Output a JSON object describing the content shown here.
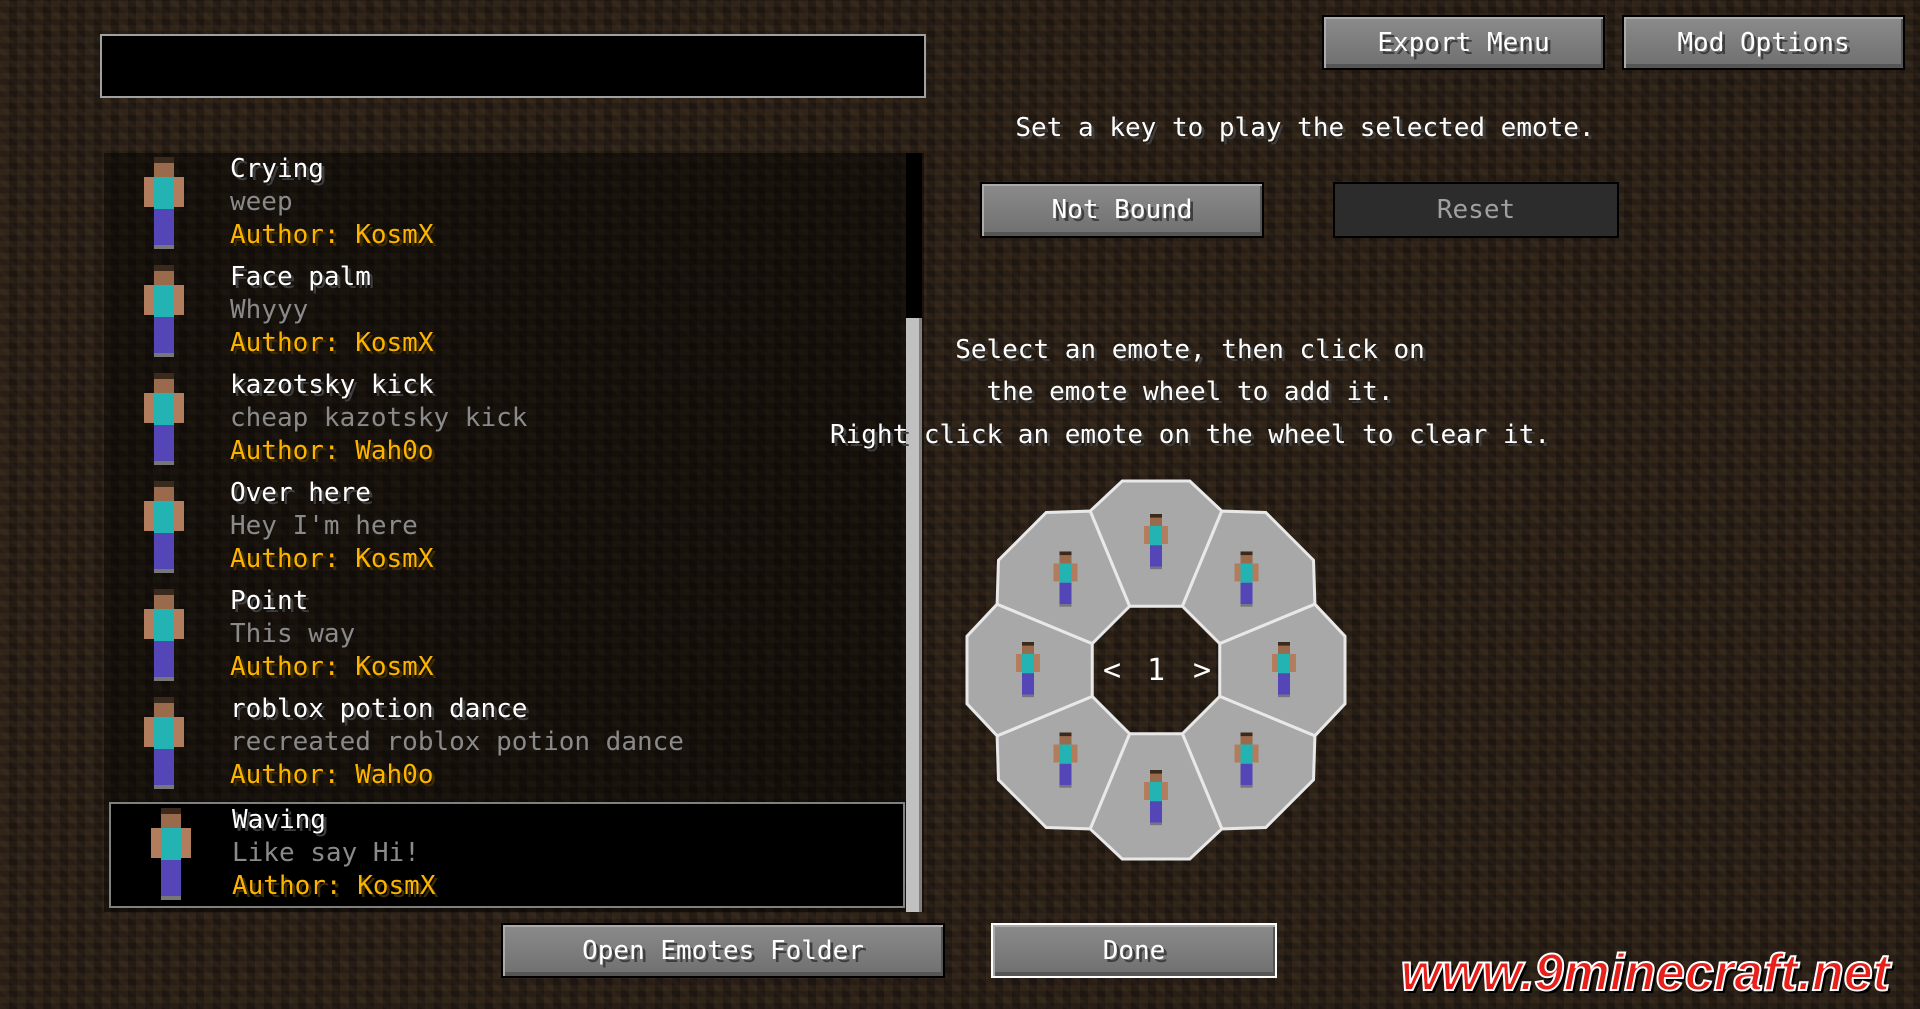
{
  "search": {
    "value": "",
    "placeholder": ""
  },
  "header": {
    "export_label": "Export Menu",
    "mod_options_label": "Mod Options"
  },
  "keybind": {
    "instruction": "Set a key to play the selected emote.",
    "key_label": "Not Bound",
    "reset_label": "Reset"
  },
  "wheel_help": {
    "line1": "Select an emote, then click on",
    "line2": "the emote wheel to add it.",
    "line3": "Right click an emote on the wheel to clear it."
  },
  "wheel": {
    "page": "1",
    "prev_icon": "chevron-left-icon",
    "next_icon": "chevron-right-icon",
    "segments": 8
  },
  "emotes": [
    {
      "title": "Crying",
      "desc": "weep",
      "author": "Author: KosmX"
    },
    {
      "title": "Face palm",
      "desc": "Whyyy",
      "author": "Author: KosmX"
    },
    {
      "title": "kazotsky kick",
      "desc": "cheap kazotsky kick",
      "author": "Author: Wah0o"
    },
    {
      "title": "Over here",
      "desc": "Hey I'm here",
      "author": "Author: KosmX"
    },
    {
      "title": "Point",
      "desc": "This way",
      "author": "Author: KosmX"
    },
    {
      "title": "roblox potion dance",
      "desc": "recreated roblox potion dance",
      "author": "Author: Wah0o"
    },
    {
      "title": "Waving",
      "desc": "Like say Hi!",
      "author": "Author: KosmX",
      "selected": true
    }
  ],
  "footer": {
    "open_folder_label": "Open Emotes Folder",
    "done_label": "Done"
  },
  "watermark": "www.9minecraft.net",
  "colors": {
    "author": "#fcb400",
    "desc": "#8a8a8a",
    "wheel": "#a8a8a8"
  }
}
